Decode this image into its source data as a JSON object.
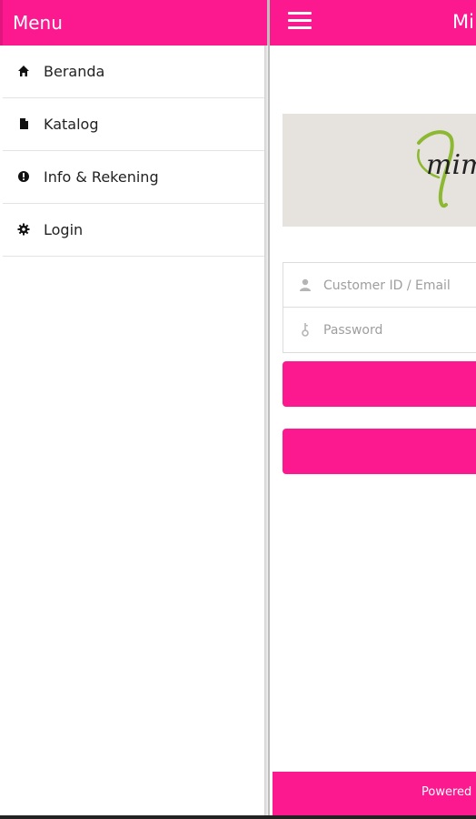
{
  "app": {
    "title": "Mi",
    "footer_text": "Powered"
  },
  "drawer": {
    "title": "Menu",
    "items": [
      {
        "label": "Beranda",
        "icon": "home-icon"
      },
      {
        "label": "Katalog",
        "icon": "document-icon"
      },
      {
        "label": "Info & Rekening",
        "icon": "info-icon"
      },
      {
        "label": "Login",
        "icon": "gear-icon"
      }
    ]
  },
  "banner": {
    "logo_text": "mim",
    "logo_accent": "V"
  },
  "login": {
    "customer_id_placeholder": "Customer ID / Email",
    "password_placeholder": "Password"
  },
  "colors": {
    "accent": "#fc188f",
    "banner_bg": "#e6e3df",
    "logo_green": "#8cb832"
  }
}
